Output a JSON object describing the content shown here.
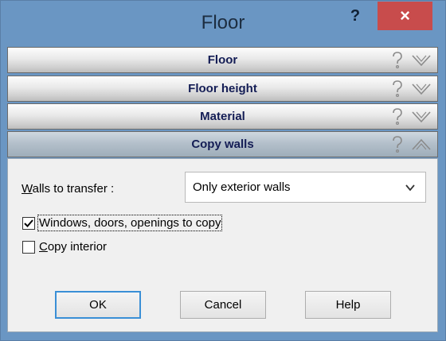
{
  "window": {
    "title": "Floor",
    "help_glyph": "?",
    "close_glyph": "×"
  },
  "sections": [
    {
      "label": "Floor",
      "expanded": false,
      "help_icon": "question-mark-icon",
      "toggle_icon": "chevron-down-icon"
    },
    {
      "label": "Floor height",
      "expanded": false,
      "help_icon": "question-mark-icon",
      "toggle_icon": "chevron-down-icon"
    },
    {
      "label": "Material",
      "expanded": false,
      "help_icon": "question-mark-icon",
      "toggle_icon": "chevron-down-icon"
    },
    {
      "label": "Copy walls",
      "expanded": true,
      "help_icon": "question-mark-icon",
      "toggle_icon": "chevron-up-icon"
    }
  ],
  "copy_walls": {
    "walls_label_mnemonic": "W",
    "walls_label_rest": "alls to transfer :",
    "walls_value": "Only exterior walls",
    "windows_label": "Windows, doors, openings to copy",
    "windows_checked": true,
    "interior_label_mnemonic": "C",
    "interior_label_rest": "opy interior",
    "interior_checked": false
  },
  "buttons": {
    "ok": "OK",
    "cancel": "Cancel",
    "help": "Help"
  },
  "colors": {
    "frame": "#6a96c3",
    "close": "#c84c4c",
    "section_label": "#141d55",
    "default_button_border": "#3a8fd6"
  }
}
